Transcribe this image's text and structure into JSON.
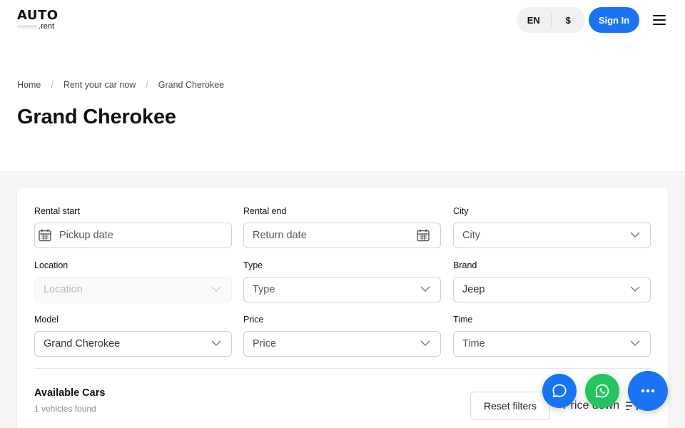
{
  "header": {
    "logo_main": "AUTO",
    "logo_sub": ".rent",
    "lang": "EN",
    "currency": "$",
    "signin_label": "Sign In"
  },
  "breadcrumb": [
    "Home",
    "Rent your car now",
    "Grand Cherokee"
  ],
  "page_title": "Grand Cherokee",
  "filters": {
    "rental_start": {
      "label": "Rental start",
      "value": "Pickup date"
    },
    "rental_end": {
      "label": "Rental end",
      "value": "Return date"
    },
    "city": {
      "label": "City",
      "value": "City"
    },
    "location": {
      "label": "Location",
      "value": "Location"
    },
    "type": {
      "label": "Type",
      "value": "Type"
    },
    "brand": {
      "label": "Brand",
      "value": "Jeep"
    },
    "model": {
      "label": "Model",
      "value": "Grand Cherokee"
    },
    "price": {
      "label": "Price",
      "value": "Price"
    },
    "time": {
      "label": "Time",
      "value": "Time"
    }
  },
  "results": {
    "title": "Available Cars",
    "count": "1 vehicles found",
    "reset_label": "Reset filters",
    "sort_label": "Price down"
  },
  "colors": {
    "accent": "#1a73f0",
    "whatsapp": "#22c55e"
  },
  "fab": {
    "chat_icon": "chat-bubble-icon",
    "whatsapp_icon": "whatsapp-icon",
    "more_icon": "more-dots-icon"
  }
}
